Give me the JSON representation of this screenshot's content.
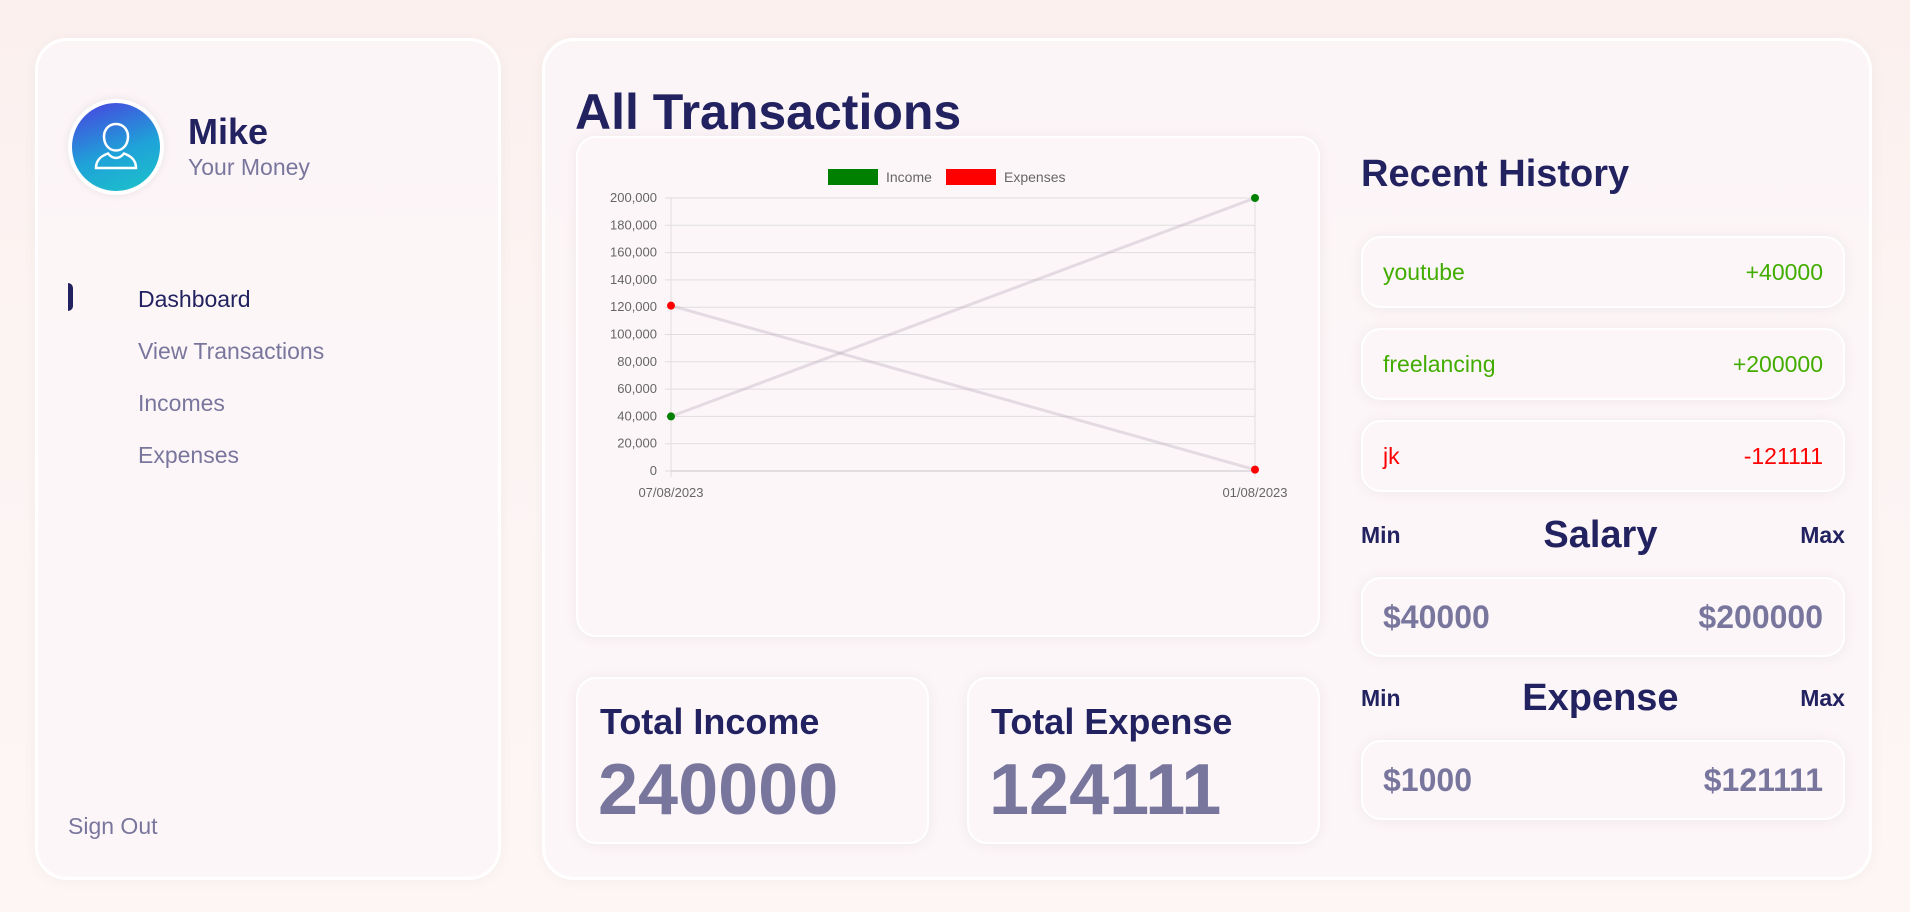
{
  "user": {
    "name": "Mike",
    "subtitle": "Your Money",
    "avatar_icon": "user-icon"
  },
  "nav": {
    "items": [
      {
        "label": "Dashboard",
        "active": true
      },
      {
        "label": "View Transactions",
        "active": false
      },
      {
        "label": "Incomes",
        "active": false
      },
      {
        "label": "Expenses",
        "active": false
      }
    ],
    "signout": "Sign Out"
  },
  "main": {
    "title": "All Transactions"
  },
  "chart_data": {
    "type": "line",
    "title": "",
    "categories": [
      "07/08/2023",
      "01/08/2023"
    ],
    "series": [
      {
        "name": "Income",
        "values": [
          40000,
          200000
        ],
        "color": "#008000"
      },
      {
        "name": "Expenses",
        "values": [
          121111,
          1000
        ],
        "color": "#ff0000"
      }
    ],
    "ylim": [
      0,
      200000
    ],
    "yticks": [
      "0",
      "20,000",
      "40,000",
      "60,000",
      "80,000",
      "100,000",
      "120,000",
      "140,000",
      "160,000",
      "180,000",
      "200,000"
    ],
    "grid": true,
    "legend": "top-center",
    "xlabel": "",
    "ylabel": ""
  },
  "totals": {
    "income_label": "Total Income",
    "income_value": "240000",
    "expense_label": "Total Expense",
    "expense_value": "124111"
  },
  "history": {
    "title": "Recent History",
    "items": [
      {
        "name": "youtube",
        "amount": "+40000",
        "type": "income"
      },
      {
        "name": "freelancing",
        "amount": "+200000",
        "type": "income"
      },
      {
        "name": "jk",
        "amount": "-121111",
        "type": "expense"
      }
    ]
  },
  "salary": {
    "min_label": "Min",
    "title": "Salary",
    "max_label": "Max",
    "min": "$40000",
    "max": "$200000"
  },
  "expense": {
    "min_label": "Min",
    "title": "Expense",
    "max_label": "Max",
    "min": "$1000",
    "max": "$121111"
  },
  "colors": {
    "primary": "#222260",
    "income": "#42ad00",
    "expense": "#ff0000",
    "muted": "rgba(34,34,96,0.6)"
  }
}
